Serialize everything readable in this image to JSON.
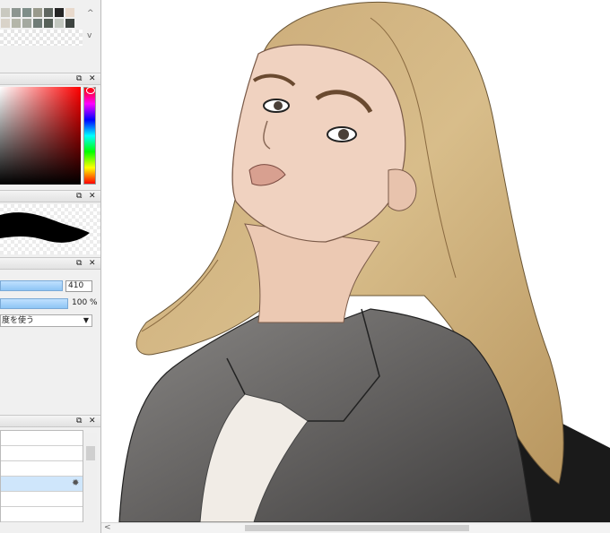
{
  "panels": {
    "swatches": {
      "colors": [
        "#c9c9c0",
        "#8c9590",
        "#7f8e89",
        "#999a8c",
        "#5f6660",
        "#242424",
        "#e8d9cc",
        "#d9d3c9",
        "#b4b6a9",
        "#a4a9a0",
        "#6f7b76",
        "#566058",
        "#c2c7bf",
        "#3d4340"
      ],
      "scroll_up": "^",
      "scroll_down": "v"
    },
    "color_picker": {
      "float_icon": "⧉",
      "close_icon": "✕",
      "accent_color": "#ff0000"
    },
    "brush_preview": {
      "float_icon": "⧉",
      "close_icon": "✕"
    },
    "brush_settings": {
      "float_icon": "⧉",
      "close_icon": "✕",
      "size_value": "410",
      "opacity_value": "100 %",
      "mode_select": "度を使う",
      "size_fill": 0.6,
      "opacity_fill": 1.0
    },
    "layers": {
      "float_icon": "⧉",
      "close_icon": "✕",
      "gear_icon": "✹"
    }
  },
  "canvas": {
    "description_icon": "illustration"
  }
}
